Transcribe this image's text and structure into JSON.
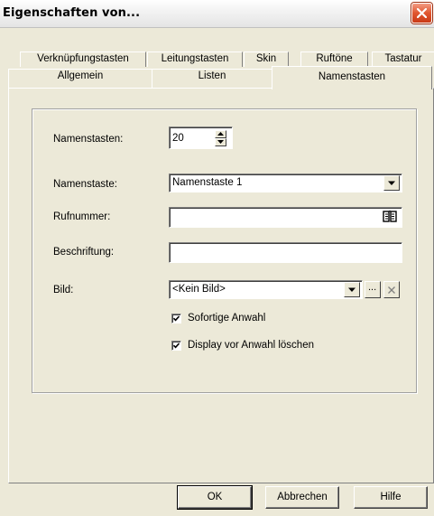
{
  "window": {
    "title": "Eigenschaften von...",
    "close_icon": "close-icon"
  },
  "tabs": {
    "row_back": [
      "Verknüpfungstasten",
      "Leitungstasten",
      "Skin",
      "Ruftöne",
      "Tastatur"
    ],
    "row_front": [
      "Allgemein",
      "Listen",
      "Namenstasten"
    ],
    "active": "Namenstasten"
  },
  "form": {
    "namenstasten_label": "Namenstasten:",
    "namenstasten_value": "20",
    "namenstaste_label": "Namenstaste:",
    "namenstaste_value": "Namenstaste 1",
    "rufnummer_label": "Rufnummer:",
    "rufnummer_value": "",
    "beschriftung_label": "Beschriftung:",
    "beschriftung_value": "",
    "bild_label": "Bild:",
    "bild_value": "<Kein Bild>",
    "bild_browse": "...",
    "sofortige_anwahl_label": "Sofortige Anwahl",
    "sofortige_anwahl_checked": true,
    "display_loeschen_label": "Display vor Anwahl löschen",
    "display_loeschen_checked": true
  },
  "buttons": {
    "ok": "OK",
    "cancel": "Abbrechen",
    "help": "Hilfe"
  }
}
